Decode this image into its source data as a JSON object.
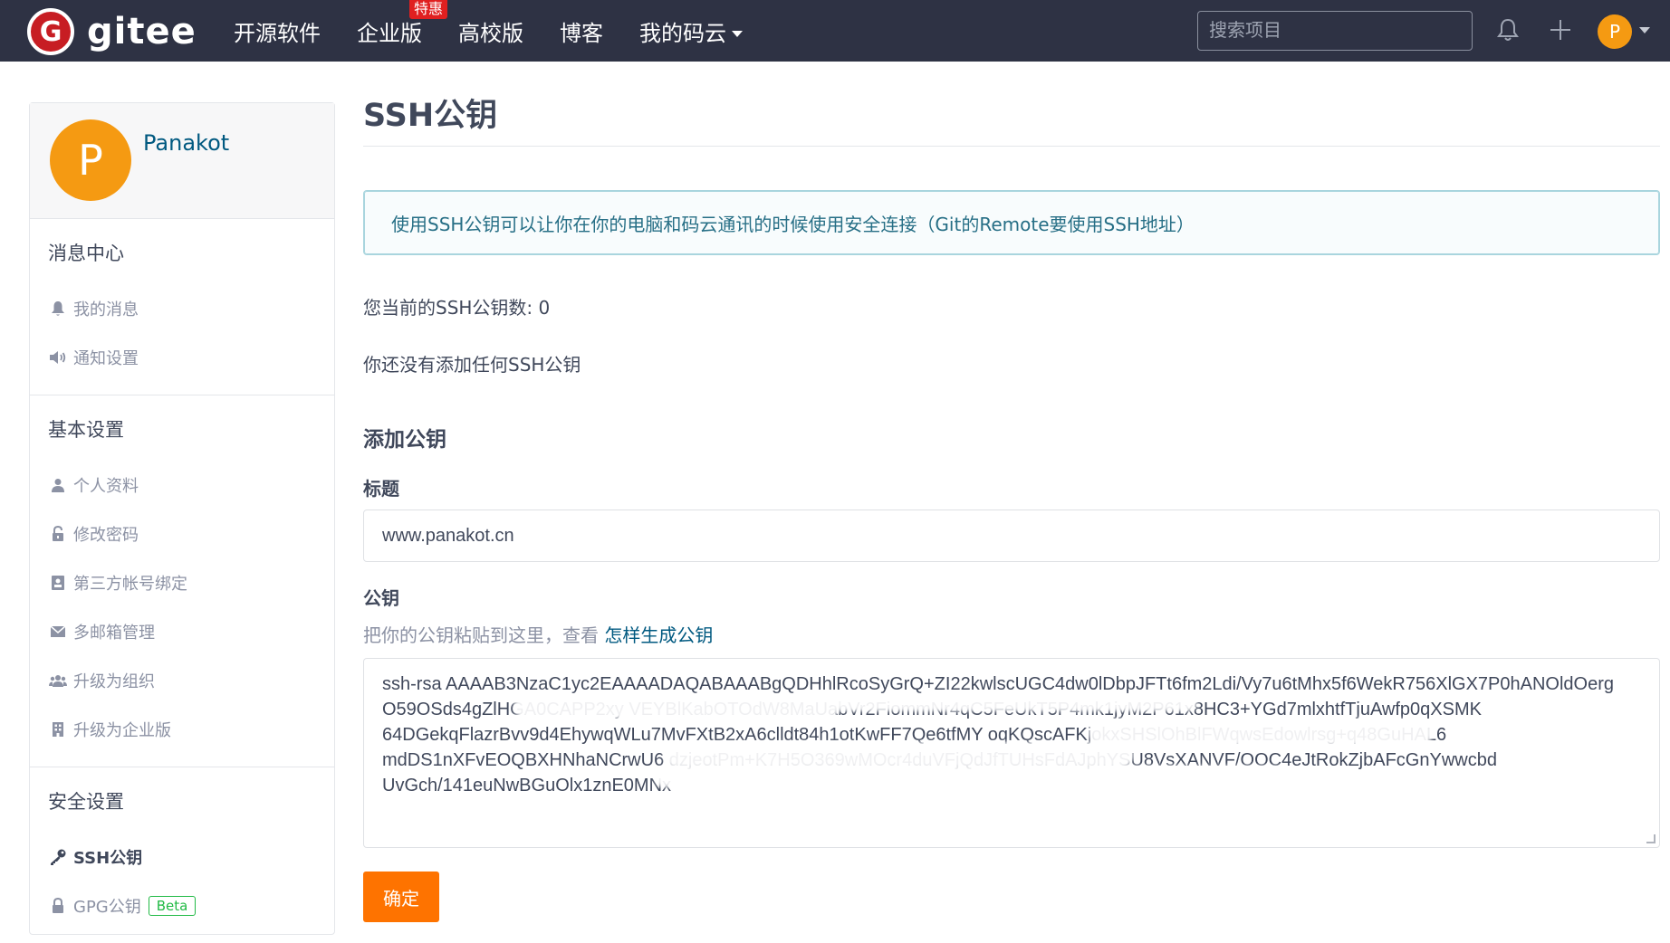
{
  "navbar": {
    "logo_letter": "G",
    "logo_text": "gitee",
    "links": [
      {
        "label": "开源软件"
      },
      {
        "label": "企业版",
        "promo": "特惠"
      },
      {
        "label": "高校版"
      },
      {
        "label": "博客"
      },
      {
        "label": "我的码云"
      }
    ],
    "search_placeholder": "搜索项目",
    "avatar_letter": "P",
    "icons": [
      "bell-icon",
      "plus-icon"
    ]
  },
  "sidebar": {
    "avatar_letter": "P",
    "username": "Panakot",
    "sections": [
      {
        "title": "消息中心",
        "items": [
          {
            "label": "我的消息",
            "icon": "bell-icon"
          },
          {
            "label": "通知设置",
            "icon": "speaker-icon"
          }
        ]
      },
      {
        "title": "基本设置",
        "items": [
          {
            "label": "个人资料",
            "icon": "user-icon"
          },
          {
            "label": "修改密码",
            "icon": "unlock-icon"
          },
          {
            "label": "第三方帐号绑定",
            "icon": "id-card-icon"
          },
          {
            "label": "多邮箱管理",
            "icon": "envelope-icon"
          },
          {
            "label": "升级为组织",
            "icon": "users-icon"
          },
          {
            "label": "升级为企业版",
            "icon": "building-icon"
          }
        ]
      },
      {
        "title": "安全设置",
        "items": [
          {
            "label": "SSH公钥",
            "icon": "key-icon",
            "active": true
          },
          {
            "label": "GPG公钥",
            "icon": "lock-icon",
            "badge": "Beta"
          }
        ]
      }
    ]
  },
  "main": {
    "title": "SSH公钥",
    "info": "使用SSH公钥可以让你在你的电脑和码云通讯的时候使用安全连接（Git的Remote要使用SSH地址）",
    "count_text": "您当前的SSH公钥数: 0",
    "none_text": "你还没有添加任何SSH公钥",
    "add_title": "添加公钥",
    "title_label": "标题",
    "title_value": "www.panakot.cn",
    "key_label": "公钥",
    "hint_text": "把你的公钥粘贴到这里，查看",
    "hint_link": "怎样生成公钥",
    "key_lines": [
      "ssh-rsa AAAAB3NzaC1yc2EAAAADAQABAAABgQDHhlRcoSyGrQ+ZI22kwlscUGC4dw0lDbpJFTt6fm2Ldi/Vy7u6tMhx5f6WekR756XlGX7P0hANOldOerg",
      "O59OSds4gZlHGA0CAPP2xy                              VEYBlKabOTOdW8MaUabVr2FiommNr4qC5FeUkT5P4mk1jyM2P61x8HC3+YGd7mlxhtfTjuAwfp0qXSMK",
      "64DGekqFlazrBvv9d4EhywqWLu7MvFXtB2xA6clldt84h1otKwFF7Qe6tfMY                    oqKQscAFKjokxSHSlOhBlFWqwsEdowlrsg+q48GuHAL6",
      "mdDS1nXFvEOQBXHNhaNCrwU6                       dzjeotPm+K7H5O369wMOcr4duVFjQdJfTUHsFdAJphYSU8VsXANVF/OOC4eJtRokZjbAFcGnYwwcbd",
      "UvGch/141euNwBGuOlx1znE0MNx"
    ],
    "confirm_label": "确定"
  },
  "colors": {
    "navbar": "#2e3244",
    "brand_red": "#c71d23",
    "avatar": "#f59a12",
    "confirm": "#fe7300",
    "link": "#005980",
    "beta": "#21ba45",
    "info_text": "#276f86"
  }
}
